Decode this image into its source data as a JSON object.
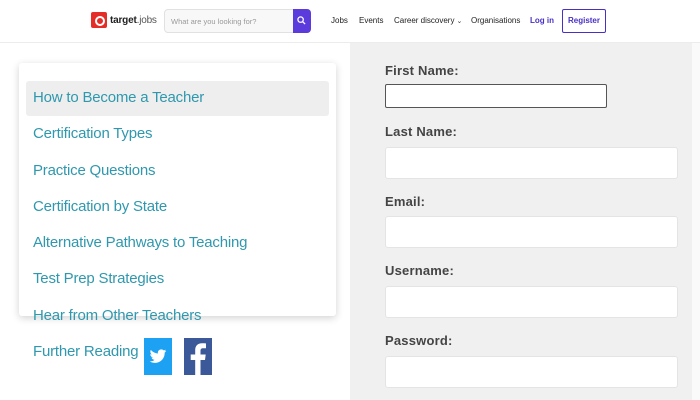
{
  "header": {
    "logo_bold": "target",
    "logo_light": "jobs",
    "search_placeholder": "What are you looking for?",
    "nav": {
      "jobs": "Jobs",
      "events": "Events",
      "career": "Career discovery",
      "orgs": "Organisations",
      "login": "Log in",
      "register": "Register"
    }
  },
  "menu": {
    "items": [
      "How to Become a Teacher",
      "Certification Types",
      "Practice Questions",
      "Certification by State",
      "Alternative Pathways to Teaching",
      "Test Prep Strategies",
      "Hear from Other Teachers",
      "Further Reading"
    ]
  },
  "social": [
    "twitter-icon",
    "facebook-icon"
  ],
  "form": {
    "first_name": "First Name:",
    "last_name": "Last Name:",
    "email": "Email:",
    "username": "Username:",
    "password": "Password:"
  },
  "colors": {
    "accent": "#4a2fc5",
    "link": "#2f98ae",
    "logo": "#e52d27",
    "twitter": "#1da1f2",
    "facebook": "#3b5998"
  }
}
